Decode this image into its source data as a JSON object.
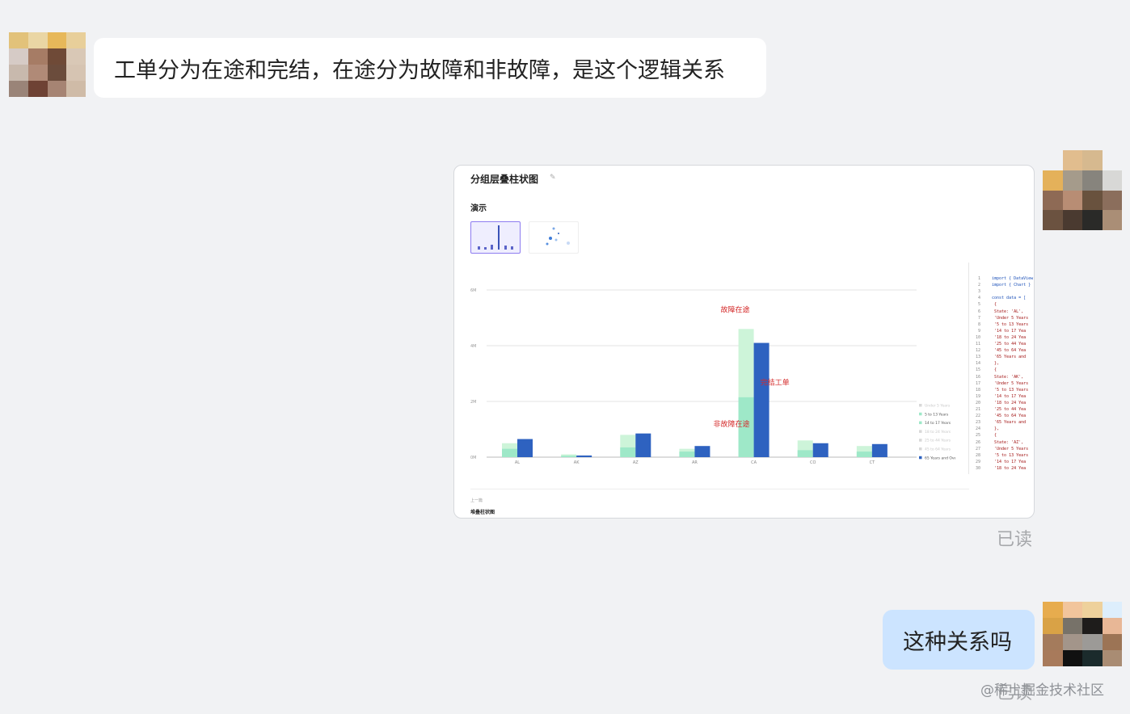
{
  "messages": {
    "first": {
      "text": "工单分为在途和完结，在途分为故障和非故障，是这个逻辑关系"
    },
    "second": {
      "read_status": "已读"
    },
    "third": {
      "text": "这种关系吗",
      "read_status": "已读"
    }
  },
  "watermark": "@稀土掘金技术社区",
  "avatar_colors": {
    "left": [
      "#e2c27a",
      "#ead6a4",
      "#e7b85a",
      "#e8cf9a",
      "#d6cbc6",
      "#a67c65",
      "#6f4a37",
      "#d9c8b6",
      "#c8b9ad",
      "#b08a77",
      "#6b4c3c",
      "#d6c4b2",
      "#9a8478",
      "#6e4234",
      "#a68473",
      "#cfbba7"
    ],
    "right1": [
      "#f1f2f4",
      "#e1bd8e",
      "#d6b98f",
      "#f1f2f4",
      "#e4b15a",
      "#a59b8b",
      "#87847d",
      "#d8d8d6",
      "#8e6a55",
      "#b88d74",
      "#69523e",
      "#8b6e5c",
      "#6b5240",
      "#4a3a30",
      "#2a2a28",
      "#aa8e76"
    ],
    "right2": [
      "#e7ac4e",
      "#f2c59c",
      "#eed19c",
      "#ddeefc",
      "#d9a246",
      "#777269",
      "#1e1c1b",
      "#e8b796",
      "#a47b5c",
      "#a3958a",
      "#9c9a97",
      "#9c7455",
      "#a87a5b",
      "#111111",
      "#1b2b2c",
      "#a98c73"
    ]
  },
  "card": {
    "title": "分组层叠柱状图",
    "demo_label": "演示",
    "prev_label": "上一篇",
    "prev_title": "堆叠柱状图",
    "code_lines": [
      {
        "n": "1",
        "t": "import { DataView"
      },
      {
        "n": "2",
        "t": "import { Chart }"
      },
      {
        "n": "3",
        "t": ""
      },
      {
        "n": "4",
        "t": "const data = ["
      },
      {
        "n": "5",
        "t": "  {"
      },
      {
        "n": "6",
        "t": "  State: 'AL',"
      },
      {
        "n": "7",
        "t": "  'Under 5 Years"
      },
      {
        "n": "8",
        "t": "  '5 to 13 Years"
      },
      {
        "n": "9",
        "t": "  '14 to 17 Yea"
      },
      {
        "n": "10",
        "t": "  '18 to 24 Yea"
      },
      {
        "n": "11",
        "t": "  '25 to 44 Yea"
      },
      {
        "n": "12",
        "t": "  '45 to 64 Yea"
      },
      {
        "n": "13",
        "t": "  '65 Years and"
      },
      {
        "n": "14",
        "t": "  },"
      },
      {
        "n": "15",
        "t": "  {"
      },
      {
        "n": "16",
        "t": "  State: 'AK',"
      },
      {
        "n": "17",
        "t": "  'Under 5 Years"
      },
      {
        "n": "18",
        "t": "  '5 to 13 Years"
      },
      {
        "n": "19",
        "t": "  '14 to 17 Yea"
      },
      {
        "n": "20",
        "t": "  '18 to 24 Yea"
      },
      {
        "n": "21",
        "t": "  '25 to 44 Yea"
      },
      {
        "n": "22",
        "t": "  '45 to 64 Yea"
      },
      {
        "n": "23",
        "t": "  '65 Years and"
      },
      {
        "n": "24",
        "t": "  },"
      },
      {
        "n": "25",
        "t": "  {"
      },
      {
        "n": "26",
        "t": "  State: 'AZ',"
      },
      {
        "n": "27",
        "t": "  'Under 5 Years"
      },
      {
        "n": "28",
        "t": "  '5 to 13 Years"
      },
      {
        "n": "29",
        "t": "  '14 to 17 Yea"
      },
      {
        "n": "30",
        "t": "  '18 to 24 Yea"
      }
    ]
  },
  "chart_data": {
    "type": "bar",
    "categories": [
      "AL",
      "AK",
      "AZ",
      "AR",
      "CA",
      "CO",
      "CT"
    ],
    "yticks": [
      "0M",
      "2M",
      "4M",
      "6M"
    ],
    "ylim": [
      0,
      6000000
    ],
    "series": [
      {
        "name": "5 to 13 Years",
        "stack": "A",
        "color": "#9ee8c8",
        "values": [
          300000,
          50000,
          350000,
          200000,
          2150000,
          250000,
          200000
        ]
      },
      {
        "name": "14 to 17 Years",
        "stack": "A",
        "color": "#cdf4d9",
        "values": [
          500000,
          100000,
          800000,
          300000,
          4600000,
          600000,
          400000
        ]
      },
      {
        "name": "65 Years and Over",
        "stack": "B",
        "color": "#2e62c0",
        "values": [
          650000,
          60000,
          850000,
          400000,
          4100000,
          500000,
          470000
        ]
      }
    ],
    "legend_items": [
      "Under 5 Years",
      "5 to 13 Years",
      "14 to 17 Years",
      "18 to 24 Years",
      "25 to 44 Years",
      "45 to 64 Years",
      "65 Years and Over"
    ],
    "legend_active": [
      false,
      true,
      true,
      false,
      false,
      false,
      true
    ],
    "legend_colors": [
      "#d8d8d8",
      "#9ee8c8",
      "#9ee8c8",
      "#d8d8d8",
      "#d8d8d8",
      "#d8d8d8",
      "#2e62c0"
    ],
    "annotations": [
      {
        "text": "故障在途",
        "category": "CA",
        "value": 5200000
      },
      {
        "text": "完结工单",
        "category": "CA",
        "value": 2600000
      },
      {
        "text": "非故障在途",
        "category": "CA",
        "value": 1100000
      }
    ]
  }
}
